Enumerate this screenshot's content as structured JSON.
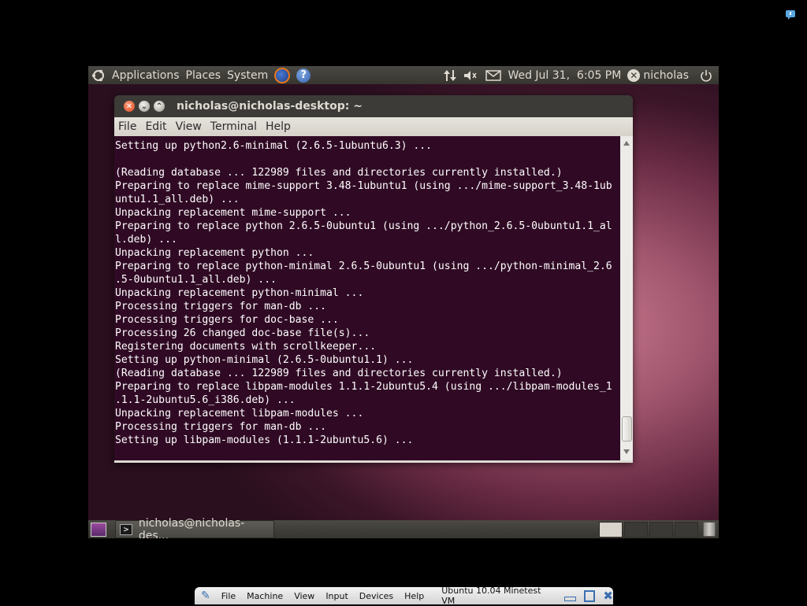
{
  "top_panel": {
    "menus": [
      "Applications",
      "Places",
      "System"
    ],
    "datetime": "Wed Jul 31,  6:05 PM",
    "username": "nicholas"
  },
  "terminal_window": {
    "title": "nicholas@nicholas-desktop: ~",
    "menu": [
      "File",
      "Edit",
      "View",
      "Terminal",
      "Help"
    ],
    "output": "Setting up python2.6-minimal (2.6.5-1ubuntu6.3) ...\n\n(Reading database ... 122989 files and directories currently installed.)\nPreparing to replace mime-support 3.48-1ubuntu1 (using .../mime-support_3.48-1ub\nuntu1.1_all.deb) ...\nUnpacking replacement mime-support ...\nPreparing to replace python 2.6.5-0ubuntu1 (using .../python_2.6.5-0ubuntu1.1_al\nl.deb) ...\nUnpacking replacement python ...\nPreparing to replace python-minimal 2.6.5-0ubuntu1 (using .../python-minimal_2.6\n.5-0ubuntu1.1_all.deb) ...\nUnpacking replacement python-minimal ...\nProcessing triggers for man-db ...\nProcessing triggers for doc-base ...\nProcessing 26 changed doc-base file(s)...\nRegistering documents with scrollkeeper...\nSetting up python-minimal (2.6.5-0ubuntu1.1) ...\n(Reading database ... 122989 files and directories currently installed.)\nPreparing to replace libpam-modules 1.1.1-2ubuntu5.4 (using .../libpam-modules_1\n.1.1-2ubuntu5.6_i386.deb) ...\nUnpacking replacement libpam-modules ...\nProcessing triggers for man-db ...\nSetting up libpam-modules (1.1.1-2ubuntu5.6) ..."
  },
  "bottom_panel": {
    "task_label": "nicholas@nicholas-des..."
  },
  "vbox_bar": {
    "menus": [
      "File",
      "Machine",
      "View",
      "Input",
      "Devices",
      "Help"
    ],
    "vm_name": "Ubuntu 10.04 Minetest VM"
  },
  "colors": {
    "terminal_bg": "#300a24",
    "panel_bg": "#3c3b37"
  }
}
